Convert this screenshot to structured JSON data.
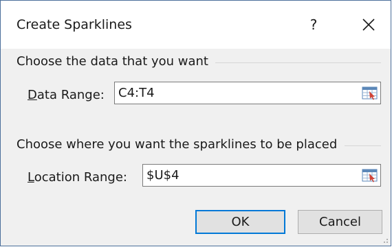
{
  "dialog": {
    "title": "Create Sparklines",
    "help_label": "?",
    "close_icon": "close-icon"
  },
  "data_group": {
    "heading": "Choose the data that you want",
    "field_label_hotkey": "D",
    "field_label_rest": "ata Range:",
    "value": "C4:T4",
    "ref_icon": "range-selector-icon"
  },
  "location_group": {
    "heading": "Choose where you want the sparklines to be placed",
    "field_label_hotkey": "L",
    "field_label_rest": "ocation Range:",
    "value": "$U$4",
    "ref_icon": "range-selector-icon"
  },
  "buttons": {
    "ok_label": "OK",
    "cancel_label": "Cancel"
  },
  "colors": {
    "accent": "#0078d7",
    "dialog_bg": "#f0f0f0",
    "border": "#4b6e9a"
  }
}
